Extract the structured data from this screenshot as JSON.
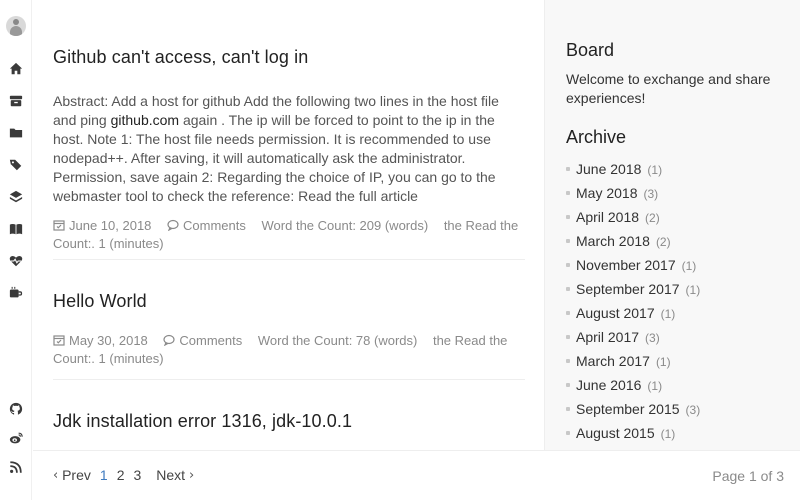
{
  "posts": [
    {
      "title": "Github can't access, can't log in",
      "abstract_before": "Abstract: Add a host for github Add the following two lines in the host file and ping ",
      "abstract_link": "github.com",
      "abstract_after": " again . The ip will be forced to point to the ip in the host. Note 1: The host file needs permission. It is recommended to use nodepad++. After saving, it will automatically ask the administrator. Permission, save again 2: Regarding the choice of IP, you can go to the webmaster tool to check the reference: Read the full article",
      "date": "June 10, 2018",
      "comments": "Comments",
      "word_count": "Word the Count: 209 (words)",
      "read_count": "the Read the Count:. 1 (minutes)"
    },
    {
      "title": "Hello World",
      "date": "May 30, 2018",
      "comments": "Comments",
      "word_count": "Word the Count: 78 (words)",
      "read_count": "the Read the Count:. 1 (minutes)"
    },
    {
      "title": "Jdk installation error 1316, jdk-10.0.1"
    }
  ],
  "sidebar": {
    "board_title": "Board",
    "board_text": "Welcome to exchange and share experiences!",
    "archive_title": "Archive",
    "archive": [
      {
        "label": "June 2018",
        "count": "(1)"
      },
      {
        "label": "May 2018",
        "count": "(3)"
      },
      {
        "label": "April 2018",
        "count": "(2)"
      },
      {
        "label": "March 2018",
        "count": "(2)"
      },
      {
        "label": "November 2017",
        "count": "(1)"
      },
      {
        "label": "September 2017",
        "count": "(1)"
      },
      {
        "label": "August 2017",
        "count": "(1)"
      },
      {
        "label": "April 2017",
        "count": "(3)"
      },
      {
        "label": "March 2017",
        "count": "(1)"
      },
      {
        "label": "June 2016",
        "count": "(1)"
      },
      {
        "label": "September 2015",
        "count": "(3)"
      },
      {
        "label": "August 2015",
        "count": "(1)"
      }
    ]
  },
  "pagination": {
    "prev": "Prev",
    "pages": [
      "1",
      "2",
      "3"
    ],
    "next": "Next",
    "info": "Page 1 of 3",
    "active_color": "#3f7bbf"
  },
  "nav_icons": [
    "home-icon",
    "archive-box-icon",
    "folder-icon",
    "tags-icon",
    "layers-icon",
    "book-icon",
    "heartbeat-icon",
    "coffee-icon",
    "github-icon",
    "weibo-icon",
    "rss-icon"
  ]
}
